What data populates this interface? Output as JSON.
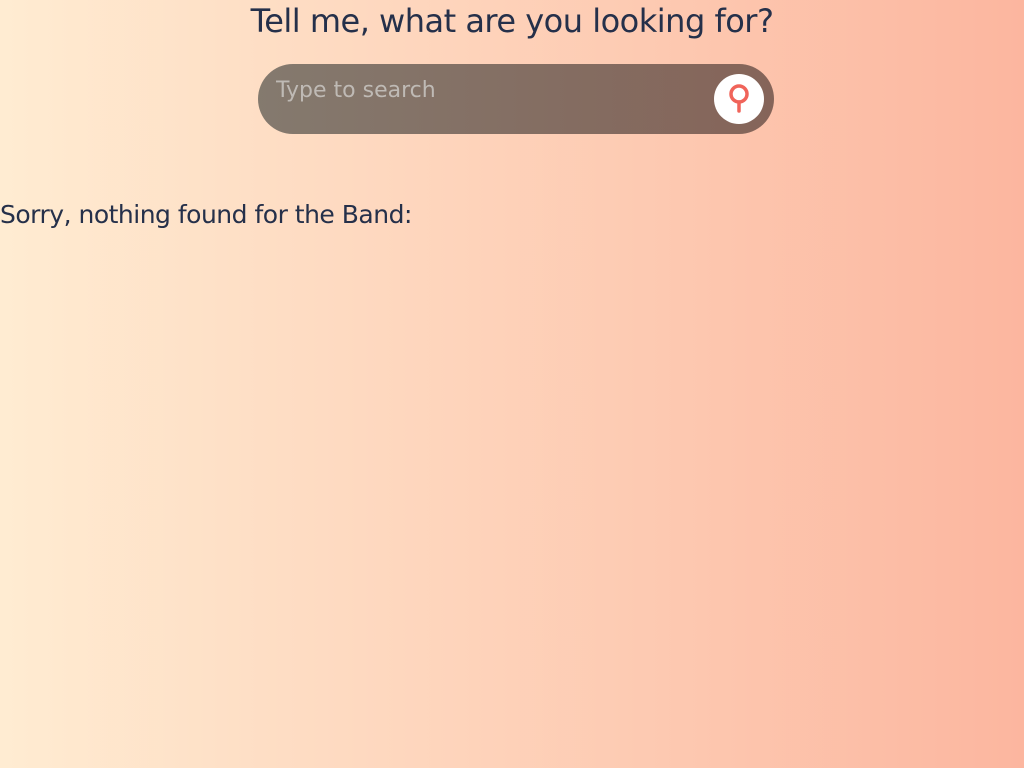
{
  "header": {
    "title": "Tell me, what are you looking for?"
  },
  "search": {
    "value": "",
    "placeholder": "Type to search",
    "button_icon": "search-icon"
  },
  "results": {
    "message": "Sorry, nothing found for the Band:"
  },
  "colors": {
    "gradient_start": "#ffecd2",
    "gradient_end": "#fcb69f",
    "text": "#25304a",
    "search_bar": "#7a6c62",
    "accent": "#f0645a",
    "button_bg": "#ffffff"
  }
}
